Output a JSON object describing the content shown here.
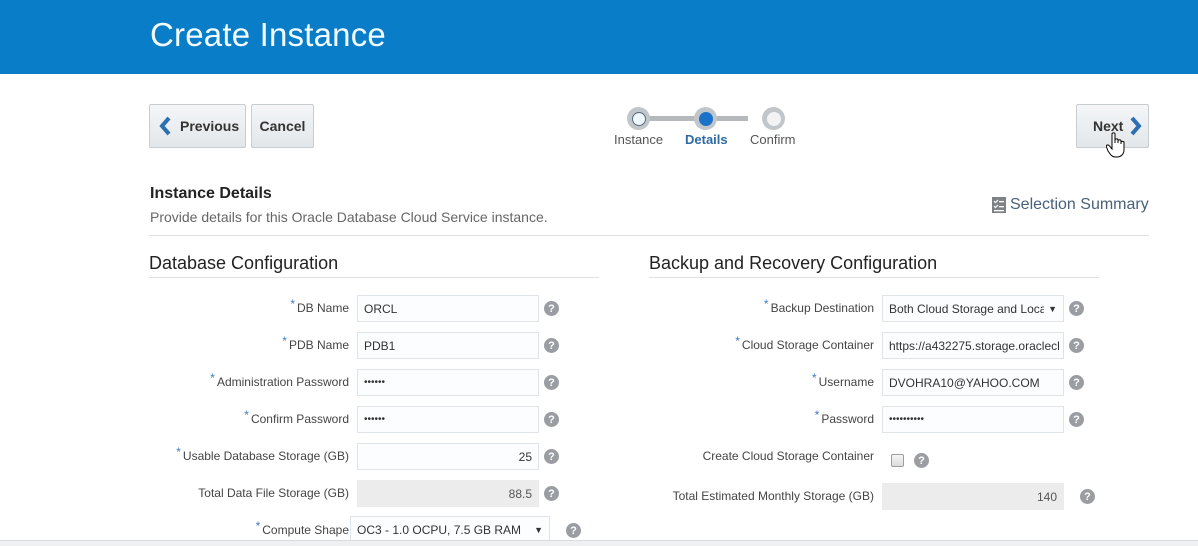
{
  "header": {
    "title": "Create Instance"
  },
  "nav": {
    "previous_label": "Previous",
    "cancel_label": "Cancel",
    "next_label": "Next"
  },
  "train": {
    "steps": [
      {
        "label": "Instance",
        "state": "visited"
      },
      {
        "label": "Details",
        "state": "current"
      },
      {
        "label": "Confirm",
        "state": "unvisited"
      }
    ]
  },
  "section": {
    "title": "Instance Details",
    "description": "Provide details for this Oracle Database Cloud Service instance.",
    "summary_link": "Selection Summary"
  },
  "database_config": {
    "title": "Database Configuration",
    "fields": [
      {
        "label": "DB Name",
        "required": true,
        "value": "ORCL",
        "type": "text"
      },
      {
        "label": "PDB Name",
        "required": true,
        "value": "PDB1",
        "type": "text"
      },
      {
        "label": "Administration Password",
        "required": true,
        "value": "••••••",
        "type": "password"
      },
      {
        "label": "Confirm Password",
        "required": true,
        "value": "••••••",
        "type": "password"
      },
      {
        "label": "Usable Database Storage (GB)",
        "required": true,
        "value": "25",
        "type": "number"
      },
      {
        "label": "Total Data File Storage (GB)",
        "required": false,
        "value": "88.5",
        "type": "readonly"
      },
      {
        "label": "Compute Shape",
        "required": true,
        "value": "OC3 - 1.0 OCPU, 7.5 GB RAM",
        "type": "select"
      }
    ]
  },
  "backup_config": {
    "title": "Backup and Recovery Configuration",
    "fields": [
      {
        "label": "Backup Destination",
        "required": true,
        "value": "Both Cloud Storage and Loca",
        "type": "select"
      },
      {
        "label": "Cloud Storage Container",
        "required": true,
        "value": "https://a432275.storage.oraclecl",
        "type": "text"
      },
      {
        "label": "Username",
        "required": true,
        "value": "DVOHRA10@YAHOO.COM",
        "type": "text"
      },
      {
        "label": "Password",
        "required": true,
        "value": "••••••••••",
        "type": "password"
      },
      {
        "label": "Create Cloud Storage Container",
        "required": false,
        "checked": false,
        "type": "checkbox"
      },
      {
        "label": "Total Estimated Monthly Storage (GB)",
        "required": false,
        "value": "140",
        "type": "readonly"
      }
    ]
  },
  "icons": {
    "help": "?",
    "required_marker": "*",
    "select_arrow": "▼"
  },
  "colors": {
    "header_bg": "#0a7dc9",
    "accent": "#2f6aa3",
    "train_active": "#1a73c8"
  }
}
